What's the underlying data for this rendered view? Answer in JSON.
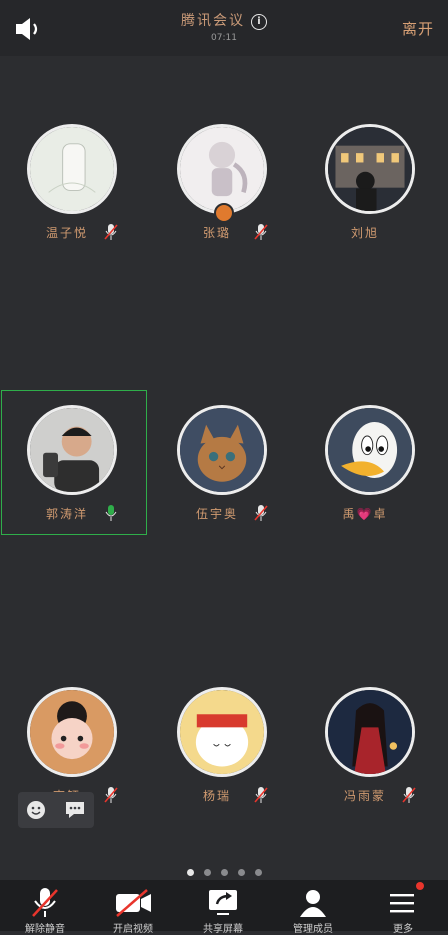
{
  "header": {
    "title": "腾讯会议",
    "time": "07:11",
    "leave_label": "离开"
  },
  "participants": [
    {
      "name": "温子悦",
      "muted": true
    },
    {
      "name": "张璐",
      "muted": true,
      "host": true
    },
    {
      "name": "刘旭",
      "muted": false
    },
    {
      "name": "郭涛洋",
      "muted": false,
      "speaking": true
    },
    {
      "name": "伍宇奥",
      "muted": true
    },
    {
      "name": "禹💗卓",
      "muted": false
    },
    {
      "name": "李钰",
      "muted": true
    },
    {
      "name": "杨瑞",
      "muted": true
    },
    {
      "name": "冯雨蒙",
      "muted": true
    }
  ],
  "pager": {
    "pages": 5,
    "current": 1
  },
  "toolbar": {
    "mute": "解除静音",
    "video": "开启视频",
    "share": "共享屏幕",
    "members": "管理成员",
    "more": "更多"
  },
  "colors": {
    "speaking": "#2fae4a",
    "muted": "#e8352c",
    "accent": "#d09a70"
  }
}
